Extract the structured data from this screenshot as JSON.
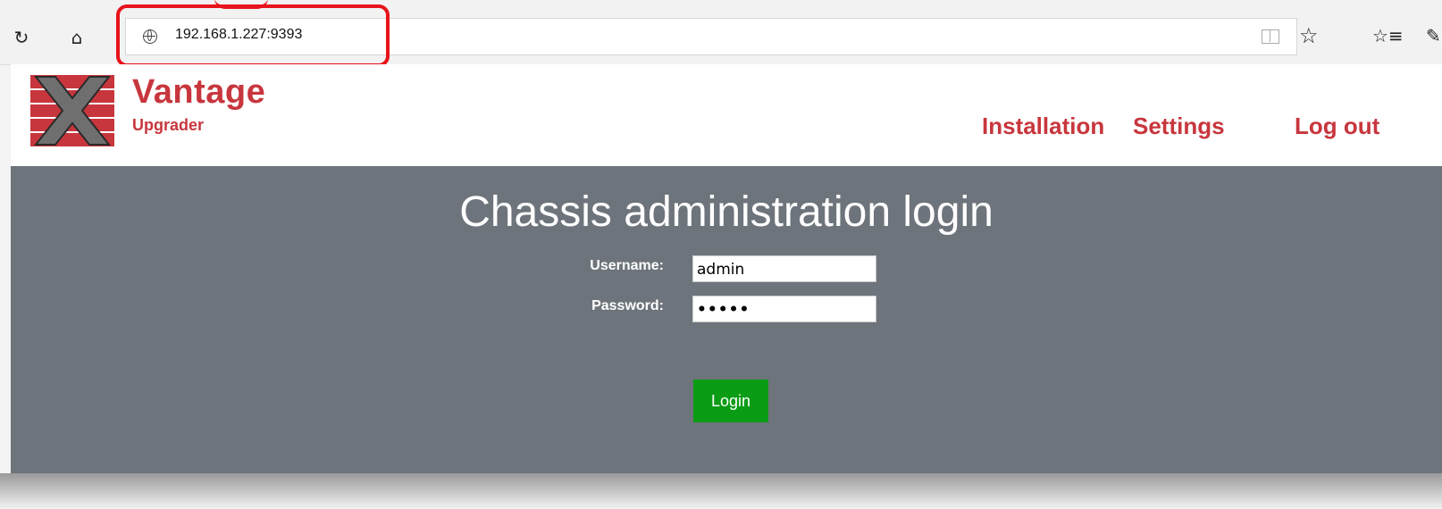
{
  "browser": {
    "url": "192.168.1.227:9393",
    "icons": [
      "refresh-icon",
      "home-icon",
      "globe-icon",
      "reading-view-icon",
      "favorite-star-icon",
      "favorites-list-icon",
      "pen-icon"
    ]
  },
  "header": {
    "brand_name": "Vantage",
    "brand_sub": "Upgrader",
    "nav": {
      "installation": "Installation",
      "settings": "Settings",
      "logout": "Log out"
    }
  },
  "login": {
    "title": "Chassis administration login",
    "username_label": "Username:",
    "username_value": "admin",
    "password_label": "Password:",
    "password_value": "•••••",
    "login_button": "Login"
  },
  "colors": {
    "brand": "#c8363d",
    "content_bg": "#6e747b",
    "login_button": "#0a9c15",
    "highlight": "#e8131b"
  }
}
